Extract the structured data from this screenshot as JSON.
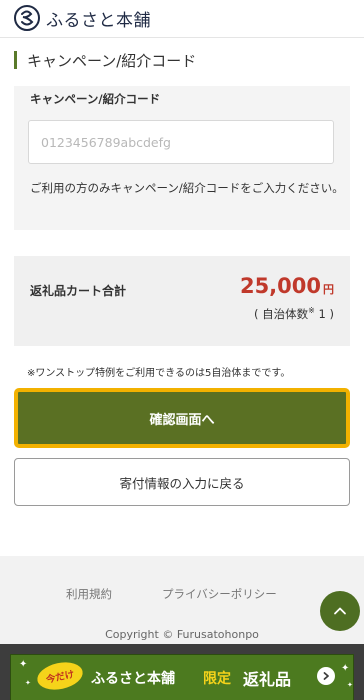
{
  "header": {
    "brand": "ふるさと本舗",
    "logo_icon": "hoshi-logo-icon"
  },
  "campaign": {
    "section_title": "キャンペーン/紹介コード",
    "field_label": "キャンペーン/紹介コード",
    "placeholder": "0123456789abcdefg",
    "value": "",
    "note": "ご利用の方のみキャンペーン/紹介コードをご入力ください。"
  },
  "cart_total": {
    "label": "返礼品カート合計",
    "amount": "25,000",
    "currency": "円",
    "municipality_prefix": "( 自治体数",
    "municipality_mark": "※",
    "municipality_count": " 1 )"
  },
  "notice": "※ワンストップ特例をご利用できるのは5自治体までです。",
  "buttons": {
    "confirm": "確認画面へ",
    "back": "寄付情報の入力に戻る"
  },
  "footer": {
    "links": [
      "利用規約",
      "プライバシーポリシー"
    ],
    "copyright": "Copyright © Furusatohonpo",
    "scroll_top_icon": "chevron-up-icon"
  },
  "banner": {
    "badge": "今だけ",
    "brand": "ふるさと本舗",
    "limited": "限定",
    "item": "返礼品",
    "arrow_icon": "chevron-right-icon"
  },
  "colors": {
    "accent_green": "#5a7023",
    "highlight_yellow": "#f2b100",
    "price_red": "#c0392b"
  }
}
